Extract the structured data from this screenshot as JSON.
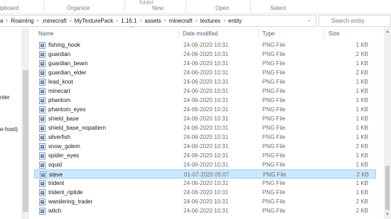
{
  "ribbon": {
    "top_fragment": "folder",
    "groups": [
      "Clipboard",
      "Organize",
      "New",
      "Open",
      "Select"
    ]
  },
  "address": {
    "breadcrumbs": [
      "a",
      "Roaming",
      ".minecraft",
      "MyTexturePack",
      "1.16.1",
      "assets",
      "minecraft",
      "textures",
      "entity"
    ],
    "search_placeholder": "Search entity"
  },
  "nav": {
    "items": [
      "nter",
      "e-host)"
    ]
  },
  "columns": {
    "name": "Name",
    "date": "Date modified",
    "type": "Type",
    "size": "Size"
  },
  "files": [
    {
      "name": "fishing_hook",
      "date": "24-06-2020 10:31",
      "type": "PNG File",
      "size": "1 KB",
      "selected": false
    },
    {
      "name": "guardian",
      "date": "24-06-2020 10:31",
      "type": "PNG File",
      "size": "2 KB",
      "selected": false
    },
    {
      "name": "guardian_beam",
      "date": "24-06-2020 10:31",
      "type": "PNG File",
      "size": "1 KB",
      "selected": false
    },
    {
      "name": "guardian_elder",
      "date": "24-06-2020 10:31",
      "type": "PNG File",
      "size": "2 KB",
      "selected": false
    },
    {
      "name": "lead_knot",
      "date": "24-06-2020 10:31",
      "type": "PNG File",
      "size": "1 KB",
      "selected": false
    },
    {
      "name": "minecart",
      "date": "24-06-2020 10:31",
      "type": "PNG File",
      "size": "1 KB",
      "selected": false
    },
    {
      "name": "phantom",
      "date": "24-06-2020 10:31",
      "type": "PNG File",
      "size": "1 KB",
      "selected": false
    },
    {
      "name": "phantom_eyes",
      "date": "24-06-2020 10:31",
      "type": "PNG File",
      "size": "1 KB",
      "selected": false
    },
    {
      "name": "shield_base",
      "date": "24-06-2020 10:31",
      "type": "PNG File",
      "size": "1 KB",
      "selected": false
    },
    {
      "name": "shield_base_nopattern",
      "date": "24-06-2020 10:31",
      "type": "PNG File",
      "size": "1 KB",
      "selected": false
    },
    {
      "name": "silverfish",
      "date": "24-06-2020 10:31",
      "type": "PNG File",
      "size": "1 KB",
      "selected": false
    },
    {
      "name": "snow_golem",
      "date": "24-06-2020 10:31",
      "type": "PNG File",
      "size": "2 KB",
      "selected": false
    },
    {
      "name": "spider_eyes",
      "date": "24-06-2020 10:31",
      "type": "PNG File",
      "size": "1 KB",
      "selected": false
    },
    {
      "name": "squid",
      "date": "24-06-2020 10:31",
      "type": "PNG File",
      "size": "1 KB",
      "selected": false
    },
    {
      "name": "steve",
      "date": "01-07-2020 05:07",
      "type": "PNG File",
      "size": "2 KB",
      "selected": true
    },
    {
      "name": "trident",
      "date": "24-06-2020 10:31",
      "type": "PNG File",
      "size": "1 KB",
      "selected": false
    },
    {
      "name": "trident_riptide",
      "date": "24-06-2020 10:31",
      "type": "PNG File",
      "size": "1 KB",
      "selected": false
    },
    {
      "name": "wandering_trader",
      "date": "24-06-2020 10:31",
      "type": "PNG File",
      "size": "2 KB",
      "selected": false
    },
    {
      "name": "witch",
      "date": "24-06-2020 10:31",
      "type": "PNG File",
      "size": "2 KB",
      "selected": false
    }
  ],
  "colors": {
    "selection_bg": "#cce8ff",
    "selection_border": "#99d1ff",
    "header_text": "#4c607a",
    "meta_text": "#6d6d6d"
  },
  "icons": {
    "file": "png-file-icon",
    "search": "search-icon",
    "chevron": "chevron-right-icon",
    "sort": "sort-caret-icon"
  }
}
